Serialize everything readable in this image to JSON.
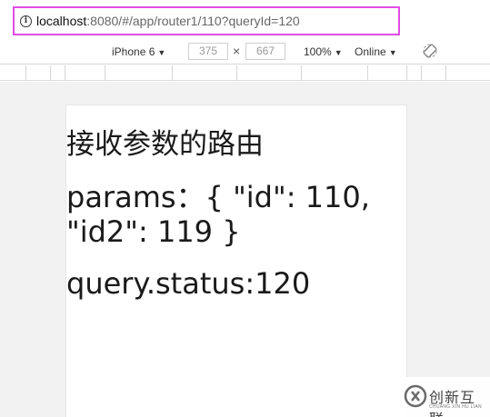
{
  "address_bar": {
    "url_host": "localhost",
    "url_rest": ":8080/#/app/router1/110?queryId=120",
    "highlight_color": "#e14de3",
    "icon": "info-icon"
  },
  "device_toolbar": {
    "device": "iPhone 6",
    "width": "375",
    "separator": "×",
    "height": "667",
    "zoom": "100%",
    "network": "Online",
    "rotate_icon": "rotate-icon"
  },
  "page": {
    "heading": "接收参数的路由",
    "params_line": "params：{ \"id\": 110, \"id2\": 119 }",
    "query_line": "query.status:120"
  },
  "watermark": {
    "text": "创新互联",
    "subtext": "CHUANG XIN HU LIAN"
  }
}
